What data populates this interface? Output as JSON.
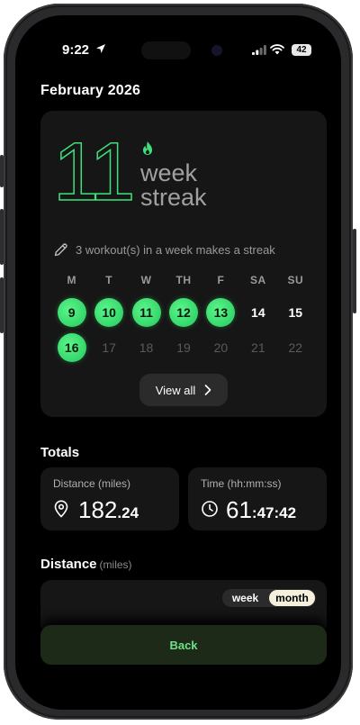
{
  "status": {
    "time": "9:22",
    "battery": "42"
  },
  "header": {
    "month": "February 2026"
  },
  "streak": {
    "count": "11",
    "line1": "week",
    "line2": "streak",
    "rule": "3 workout(s) in a week makes a streak",
    "weekdays": [
      "M",
      "T",
      "W",
      "TH",
      "F",
      "SA",
      "SU"
    ],
    "week1": [
      "9",
      "10",
      "11",
      "12",
      "13",
      "14",
      "15"
    ],
    "week2": [
      "16",
      "17",
      "18",
      "19",
      "20",
      "21",
      "22"
    ],
    "view_all": "View all"
  },
  "totals": {
    "title": "Totals",
    "distance_label": "Distance (miles)",
    "distance_main": "182",
    "distance_frac": ".24",
    "time_label": "Time (hh:mm:ss)",
    "time_main": "61",
    "time_frac": ":47:42"
  },
  "distance": {
    "title": "Distance",
    "unit": "(miles)",
    "toggle_week": "week",
    "toggle_month": "month",
    "active": "month"
  },
  "footer": {
    "back": "Back"
  },
  "colors": {
    "accent": "#3ee07a",
    "background": "#000000",
    "card": "#161616"
  }
}
